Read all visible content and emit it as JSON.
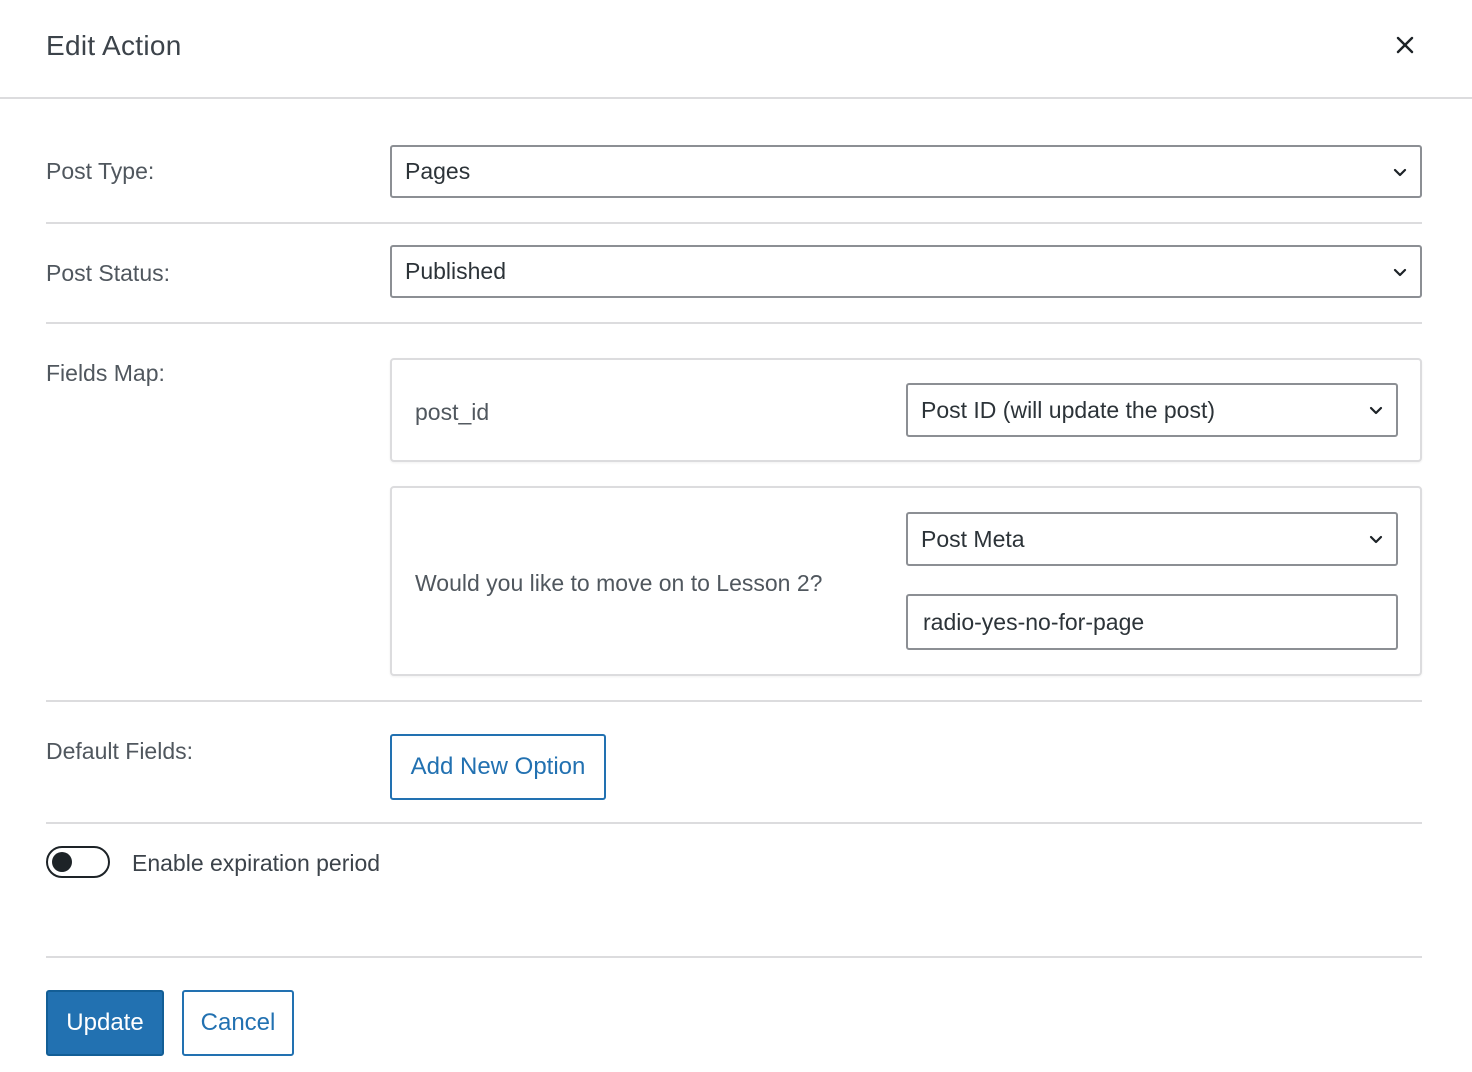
{
  "dialog": {
    "title": "Edit Action",
    "close_icon": "close-icon"
  },
  "post_type": {
    "label": "Post Type:",
    "selected": "Pages"
  },
  "post_status": {
    "label": "Post Status:",
    "selected": "Published"
  },
  "fields_map": {
    "label": "Fields Map:",
    "rows": [
      {
        "field": "post_id",
        "mapping": "Post ID (will update the post)"
      },
      {
        "field": "Would you like to move on to Lesson 2?",
        "mapping": "Post Meta",
        "meta_key": "radio-yes-no-for-page"
      }
    ]
  },
  "default_fields": {
    "label": "Default Fields:",
    "add_button": "Add New Option"
  },
  "expiration": {
    "label": "Enable expiration period",
    "enabled": false
  },
  "footer": {
    "update_label": "Update",
    "cancel_label": "Cancel"
  },
  "colors": {
    "accent": "#2271b1",
    "border": "#8c8f94",
    "divider": "#dcdcde",
    "text": "#1d2327"
  }
}
